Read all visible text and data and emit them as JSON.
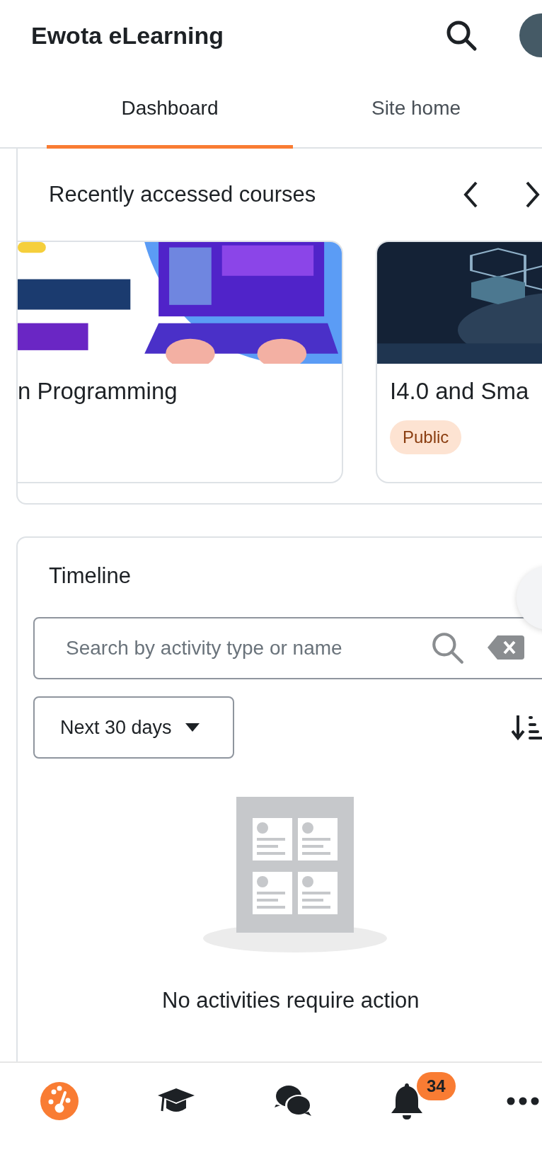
{
  "header": {
    "title": "Ewota eLearning"
  },
  "tabs": [
    {
      "label": "Dashboard",
      "selected": true
    },
    {
      "label": "Site home",
      "selected": false
    }
  ],
  "recent_courses": {
    "title": "Recently accessed courses",
    "courses": [
      {
        "name": "n Programming"
      },
      {
        "name": "I4.0 and Sma",
        "badge": "Public"
      }
    ]
  },
  "timeline": {
    "title": "Timeline",
    "search": {
      "placeholder": "Search by activity type or name"
    },
    "filter": "Next 30 days",
    "empty_message": "No activities require action"
  },
  "bottom_nav": [
    {
      "kind": "dashboard",
      "selected": true
    },
    {
      "kind": "courses",
      "selected": false
    },
    {
      "kind": "messages",
      "selected": false
    },
    {
      "kind": "notifications",
      "selected": false,
      "badge": "34"
    },
    {
      "kind": "more",
      "selected": false
    }
  ]
}
